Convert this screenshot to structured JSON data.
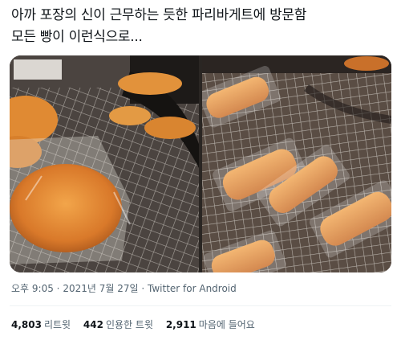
{
  "tweet": {
    "text_line1": "아까 포장의 신이 근무하는 듯한 파리바게트에 방문함",
    "text_line2": "모든 빵이 이런식으로..."
  },
  "meta": {
    "time": "오후 9:05",
    "date": "2021년 7월 27일",
    "source": "Twitter for Android",
    "separator": "·"
  },
  "stats": [
    {
      "count": "4,803",
      "label": "리트윗"
    },
    {
      "count": "442",
      "label": "인용한 트윗"
    },
    {
      "count": "2,911",
      "label": "마음에 들어요"
    }
  ]
}
